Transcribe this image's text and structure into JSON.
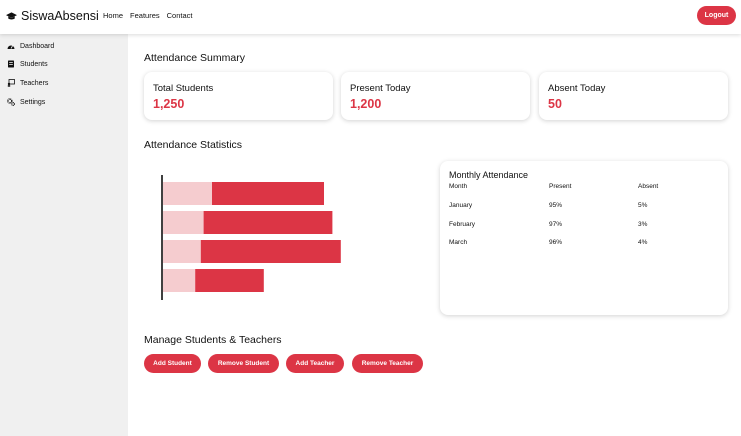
{
  "header": {
    "brand": "SiswaAbsensi",
    "brand_icon": "graduation-cap-icon",
    "nav": [
      "Home",
      "Features",
      "Contact"
    ],
    "logout_label": "Logout"
  },
  "sidebar": {
    "items": [
      {
        "label": "Dashboard",
        "icon": "dashboard-icon"
      },
      {
        "label": "Students",
        "icon": "students-icon"
      },
      {
        "label": "Teachers",
        "icon": "teachers-icon"
      },
      {
        "label": "Settings",
        "icon": "settings-icon"
      }
    ]
  },
  "summary": {
    "title": "Attendance Summary",
    "cards": [
      {
        "label": "Total Students",
        "value": "1,250"
      },
      {
        "label": "Present Today",
        "value": "1,200"
      },
      {
        "label": "Absent Today",
        "value": "50"
      }
    ]
  },
  "statistics": {
    "title": "Attendance Statistics"
  },
  "chart_data": {
    "type": "bar",
    "orientation": "horizontal",
    "stacked": true,
    "series": [
      {
        "values": [
          0.35,
          0.29,
          0.27,
          0.23
        ],
        "color": "#f5cccf"
      },
      {
        "values": [
          0.8,
          0.92,
          1.0,
          0.49
        ],
        "color": "#dc3545"
      }
    ],
    "xlabel": "",
    "ylabel": "",
    "title": "",
    "grid": false
  },
  "monthly": {
    "title": "Monthly Attendance",
    "headers": [
      "Month",
      "Present",
      "Absent"
    ],
    "rows": [
      [
        "January",
        "95%",
        "5%"
      ],
      [
        "February",
        "97%",
        "3%"
      ],
      [
        "March",
        "96%",
        "4%"
      ]
    ]
  },
  "manage": {
    "title": "Manage Students & Teachers",
    "buttons": [
      "Add Student",
      "Remove Student",
      "Add Teacher",
      "Remove Teacher"
    ]
  },
  "colors": {
    "accent": "#dc3545",
    "accent_light": "#f5cccf",
    "sidebar_bg": "#f0f0f0"
  }
}
